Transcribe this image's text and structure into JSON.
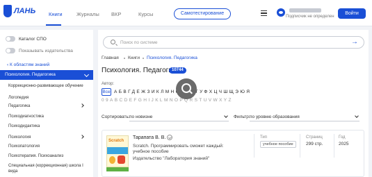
{
  "header": {
    "logo_text": "ЛАНЬ",
    "tabs": [
      {
        "label": "Книги",
        "active": true
      },
      {
        "label": "Журналы",
        "active": false
      },
      {
        "label": "ВКР",
        "active": false
      },
      {
        "label": "Курсы",
        "active": false
      }
    ],
    "self_test_label": "Самотестирование",
    "subscriber_text": "Подписчик не определен",
    "login_label": "Войти"
  },
  "sidebar": {
    "toggles": [
      {
        "label": "Каталог СПО"
      },
      {
        "label": "Показывать издательства"
      }
    ],
    "back_label": "К областям знаний",
    "active_category": "Психология. Педагогика",
    "items": [
      {
        "label": "Коррекционно-развивающее обучение",
        "has_children": false
      },
      {
        "label": "Логопедия",
        "has_children": false
      },
      {
        "label": "Педагогика",
        "has_children": true
      },
      {
        "label": "Психодиагностика",
        "has_children": false
      },
      {
        "label": "Психодидактика",
        "has_children": false
      },
      {
        "label": "Психология",
        "has_children": true
      },
      {
        "label": "Психопатология",
        "has_children": false
      },
      {
        "label": "Психотерапия. Психоанализ",
        "has_children": false
      },
      {
        "label": "Специальная (коррекционная) школа I вида",
        "has_children": false
      }
    ]
  },
  "main": {
    "search_placeholder": "Поиск по системе",
    "breadcrumbs": [
      "Главная",
      "Книги",
      "Психология. Педагогика"
    ],
    "title": "Психология. Педагогика",
    "count": "10744",
    "author_label": "Автор:",
    "all_label": "Все",
    "alphabet_ru": "АБВГДЕЖЗИКЛМНОПРСТУФХЦЧШЩЭЮЯ",
    "alphabet_lat": "09ABCDEFGHIJKLMNOPQRSTUVWXYZ",
    "sort_label": "Сортировать:",
    "sort_value": "по новизне",
    "filter_label": "Фильтр:",
    "filter_value": "по уровню образования",
    "book": {
      "cover_title": "Scratch",
      "author": "Тарапата В. В.",
      "title": "Scratch. Программировать сможет каждый: учебное пособие",
      "publisher": "Издательство \"Лаборатория знаний\"",
      "type_header": "Тип",
      "type_value": "учебное пособие",
      "pages_header": "Страниц",
      "pages_value": "299 стр.",
      "year_header": "Год",
      "year_value": "2025"
    }
  }
}
